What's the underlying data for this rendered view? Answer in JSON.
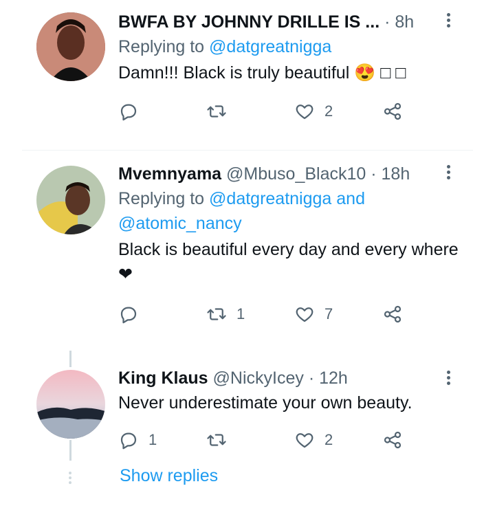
{
  "tweets": [
    {
      "name": "BWFA BY JOHNNY DRILLE IS ...",
      "handle": "",
      "time": "· 8h",
      "replying_prefix": "Replying to ",
      "replying_to": "@datgreatnigga",
      "replying_to_2": "",
      "text": "Damn!!! Black is truly beautiful 😍 □ □",
      "counts": {
        "reply": "",
        "retweet": "",
        "like": "2"
      }
    },
    {
      "name": "Mvemnyama",
      "handle": "@Mbuso_Black10",
      "time": "· 18h",
      "replying_prefix": "Replying to ",
      "replying_to": "@datgreatnigga and",
      "replying_to_2": "@atomic_nancy",
      "text": "Black is beautiful every day and every where❤",
      "counts": {
        "reply": "",
        "retweet": "1",
        "like": "7"
      }
    },
    {
      "name": "King Klaus",
      "handle": "@NickyIcey",
      "time": "· 12h",
      "text": "Never underestimate your own beauty.",
      "counts": {
        "reply": "1",
        "retweet": "",
        "like": "2"
      }
    }
  ],
  "show_replies": "Show replies",
  "colors": {
    "link": "#1d9bf0",
    "secondary": "#536471",
    "text": "#0f1419"
  }
}
